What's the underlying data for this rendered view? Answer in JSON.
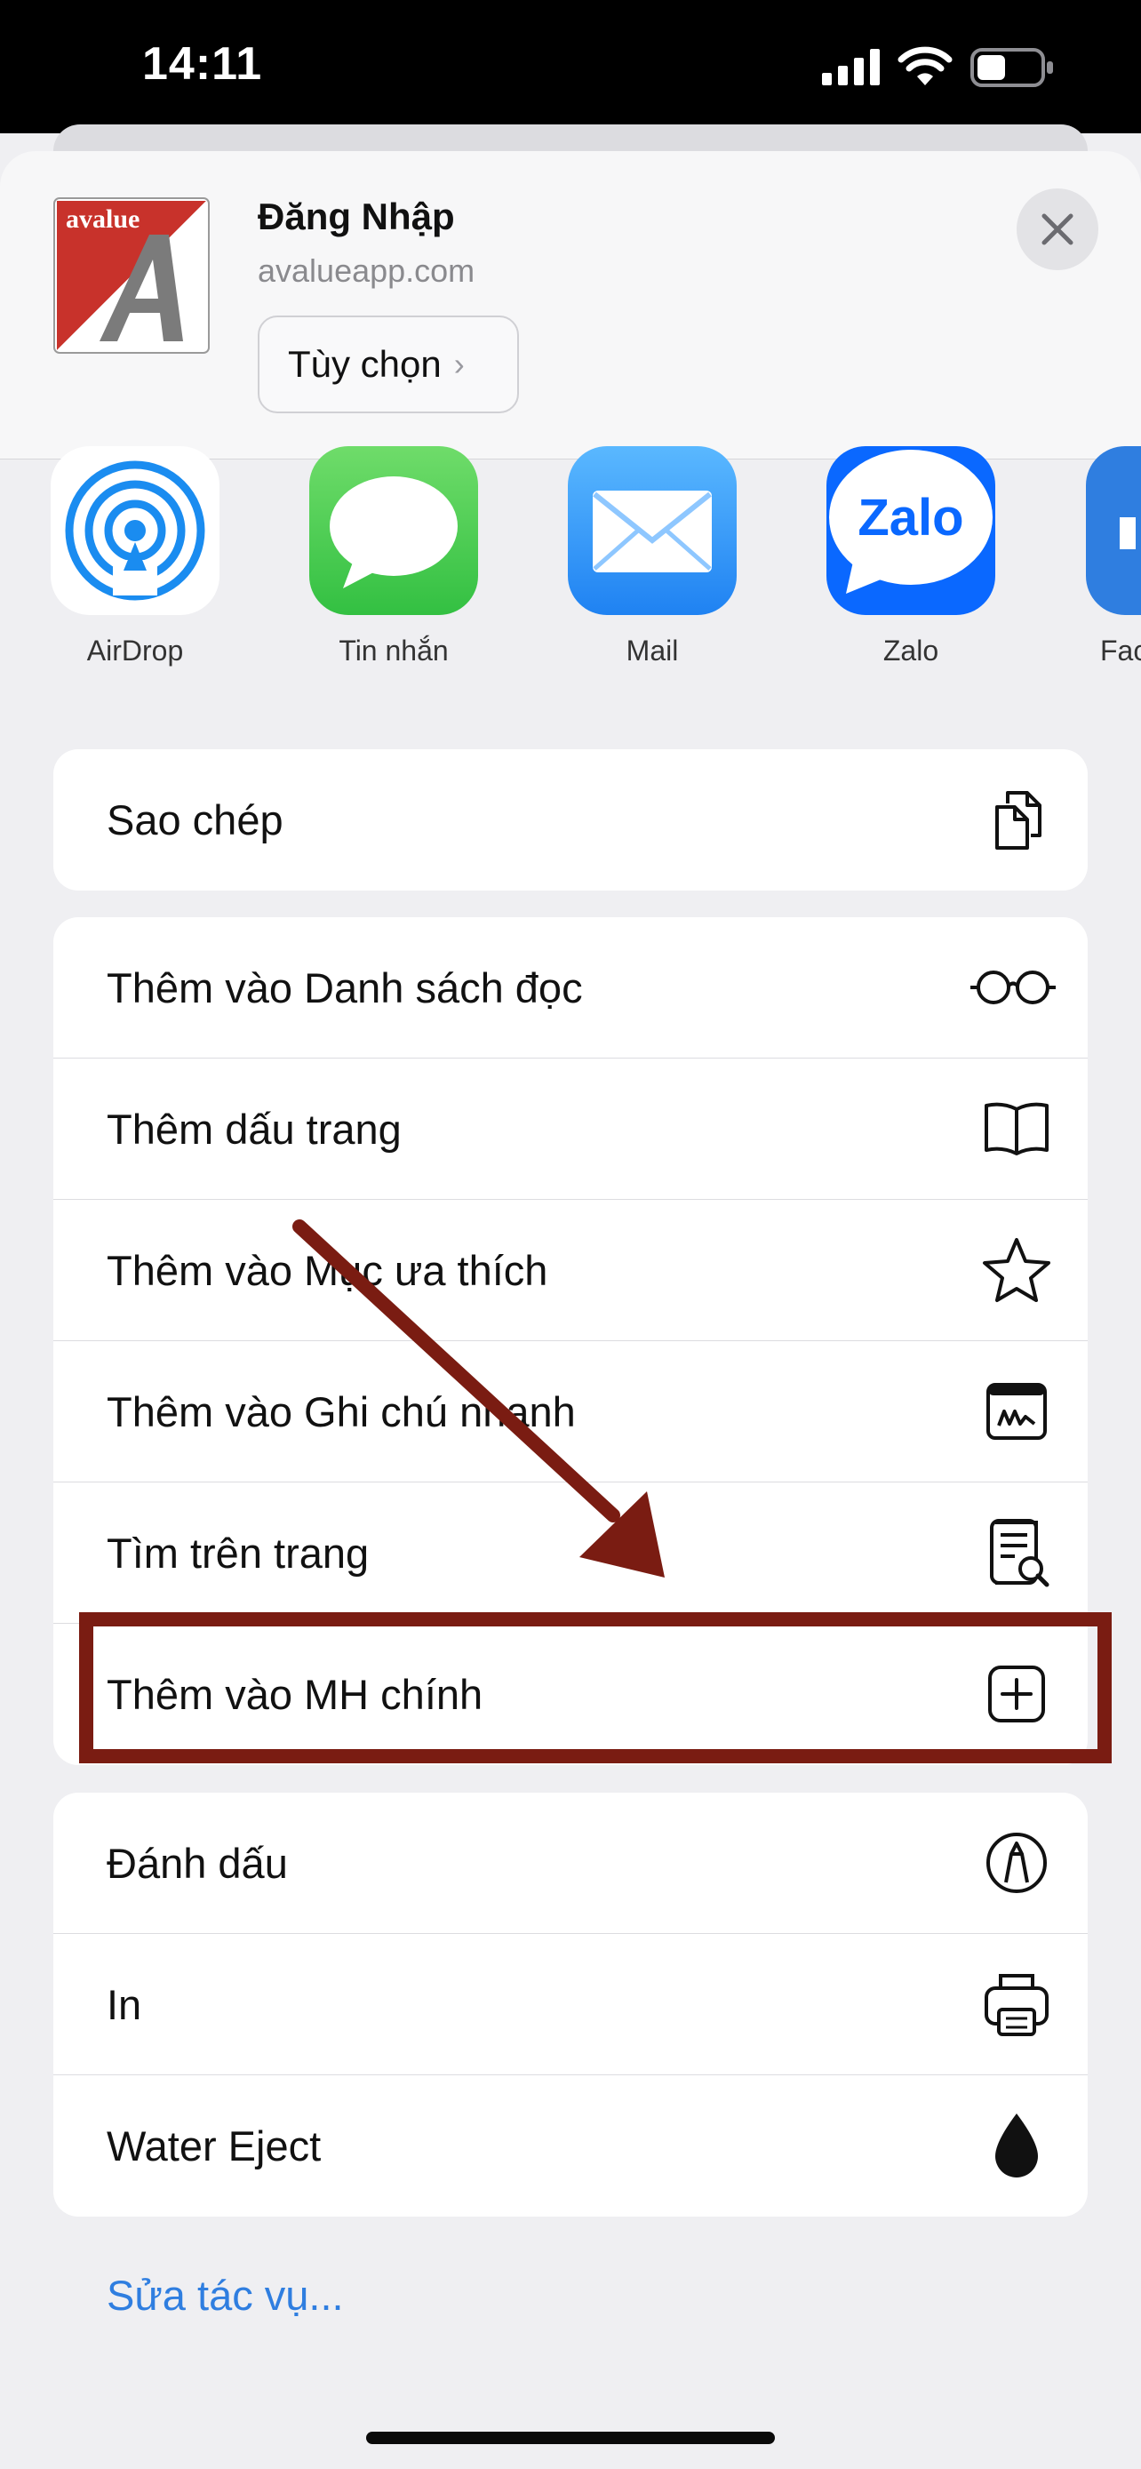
{
  "status_bar": {
    "time": "14:11",
    "battery_level": 0.45
  },
  "share_header": {
    "logo_text": "avalue",
    "title": "Đăng Nhập",
    "domain": "avalueapp.com",
    "options_label": "Tùy chọn"
  },
  "apps": [
    {
      "label": "AirDrop",
      "icon": "airdrop-icon"
    },
    {
      "label": "Tin nhắn",
      "icon": "messages-icon"
    },
    {
      "label": "Mail",
      "icon": "mail-icon"
    },
    {
      "label": "Zalo",
      "icon": "zalo-icon",
      "icon_text": "Zalo"
    },
    {
      "label": "Fac",
      "icon": "facebook-icon"
    }
  ],
  "groups": [
    [
      {
        "label": "Sao chép",
        "icon": "copy-icon"
      }
    ],
    [
      {
        "label": "Thêm vào Danh sách đọc",
        "icon": "glasses-icon"
      },
      {
        "label": "Thêm dấu trang",
        "icon": "book-icon"
      },
      {
        "label": "Thêm vào Mục ưa thích",
        "icon": "star-icon"
      },
      {
        "label": "Thêm vào Ghi chú nhanh",
        "icon": "quick-note-icon"
      },
      {
        "label": "Tìm trên trang",
        "icon": "find-on-page-icon"
      },
      {
        "label": "Thêm vào MH chính",
        "icon": "add-square-icon"
      }
    ],
    [
      {
        "label": "Đánh dấu",
        "icon": "markup-icon"
      },
      {
        "label": "In",
        "icon": "printer-icon"
      },
      {
        "label": "Water Eject",
        "icon": "water-drop-icon"
      }
    ]
  ],
  "edit_actions_label": "Sửa tác vụ...",
  "colors": {
    "link": "#2f7ee0",
    "annotation": "#7a1c12",
    "logo_red": "#c8322b"
  }
}
